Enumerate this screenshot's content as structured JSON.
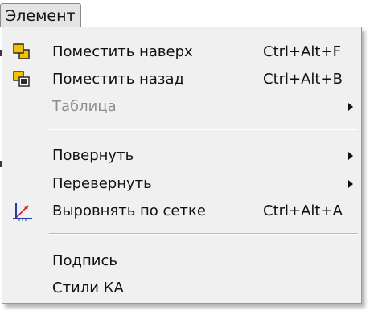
{
  "menu": {
    "title": "Элемент",
    "items": [
      {
        "label": "Поместить наверх",
        "shortcut": "Ctrl+Alt+F",
        "icon": "bring-to-front-icon"
      },
      {
        "label": "Поместить назад",
        "shortcut": "Ctrl+Alt+B",
        "icon": "send-to-back-icon"
      },
      {
        "label": "Таблица",
        "shortcut": "",
        "disabled": true,
        "submenu": true
      },
      {
        "label": "Повернуть",
        "shortcut": "",
        "submenu": true
      },
      {
        "label": "Перевернуть",
        "shortcut": "",
        "submenu": true
      },
      {
        "label": "Выровнять по сетке",
        "shortcut": "Ctrl+Alt+A",
        "icon": "align-to-grid-icon"
      },
      {
        "label": "Подпись",
        "shortcut": ""
      },
      {
        "label": "Стили КА",
        "shortcut": ""
      }
    ]
  },
  "colors": {
    "menu_background": "#f0f0f0",
    "disabled_text": "#8e8e8e",
    "icon_yellow": "#f2c200",
    "icon_dark": "#2b2b2b",
    "icon_blue": "#1e3fa8",
    "icon_red": "#d22020"
  }
}
